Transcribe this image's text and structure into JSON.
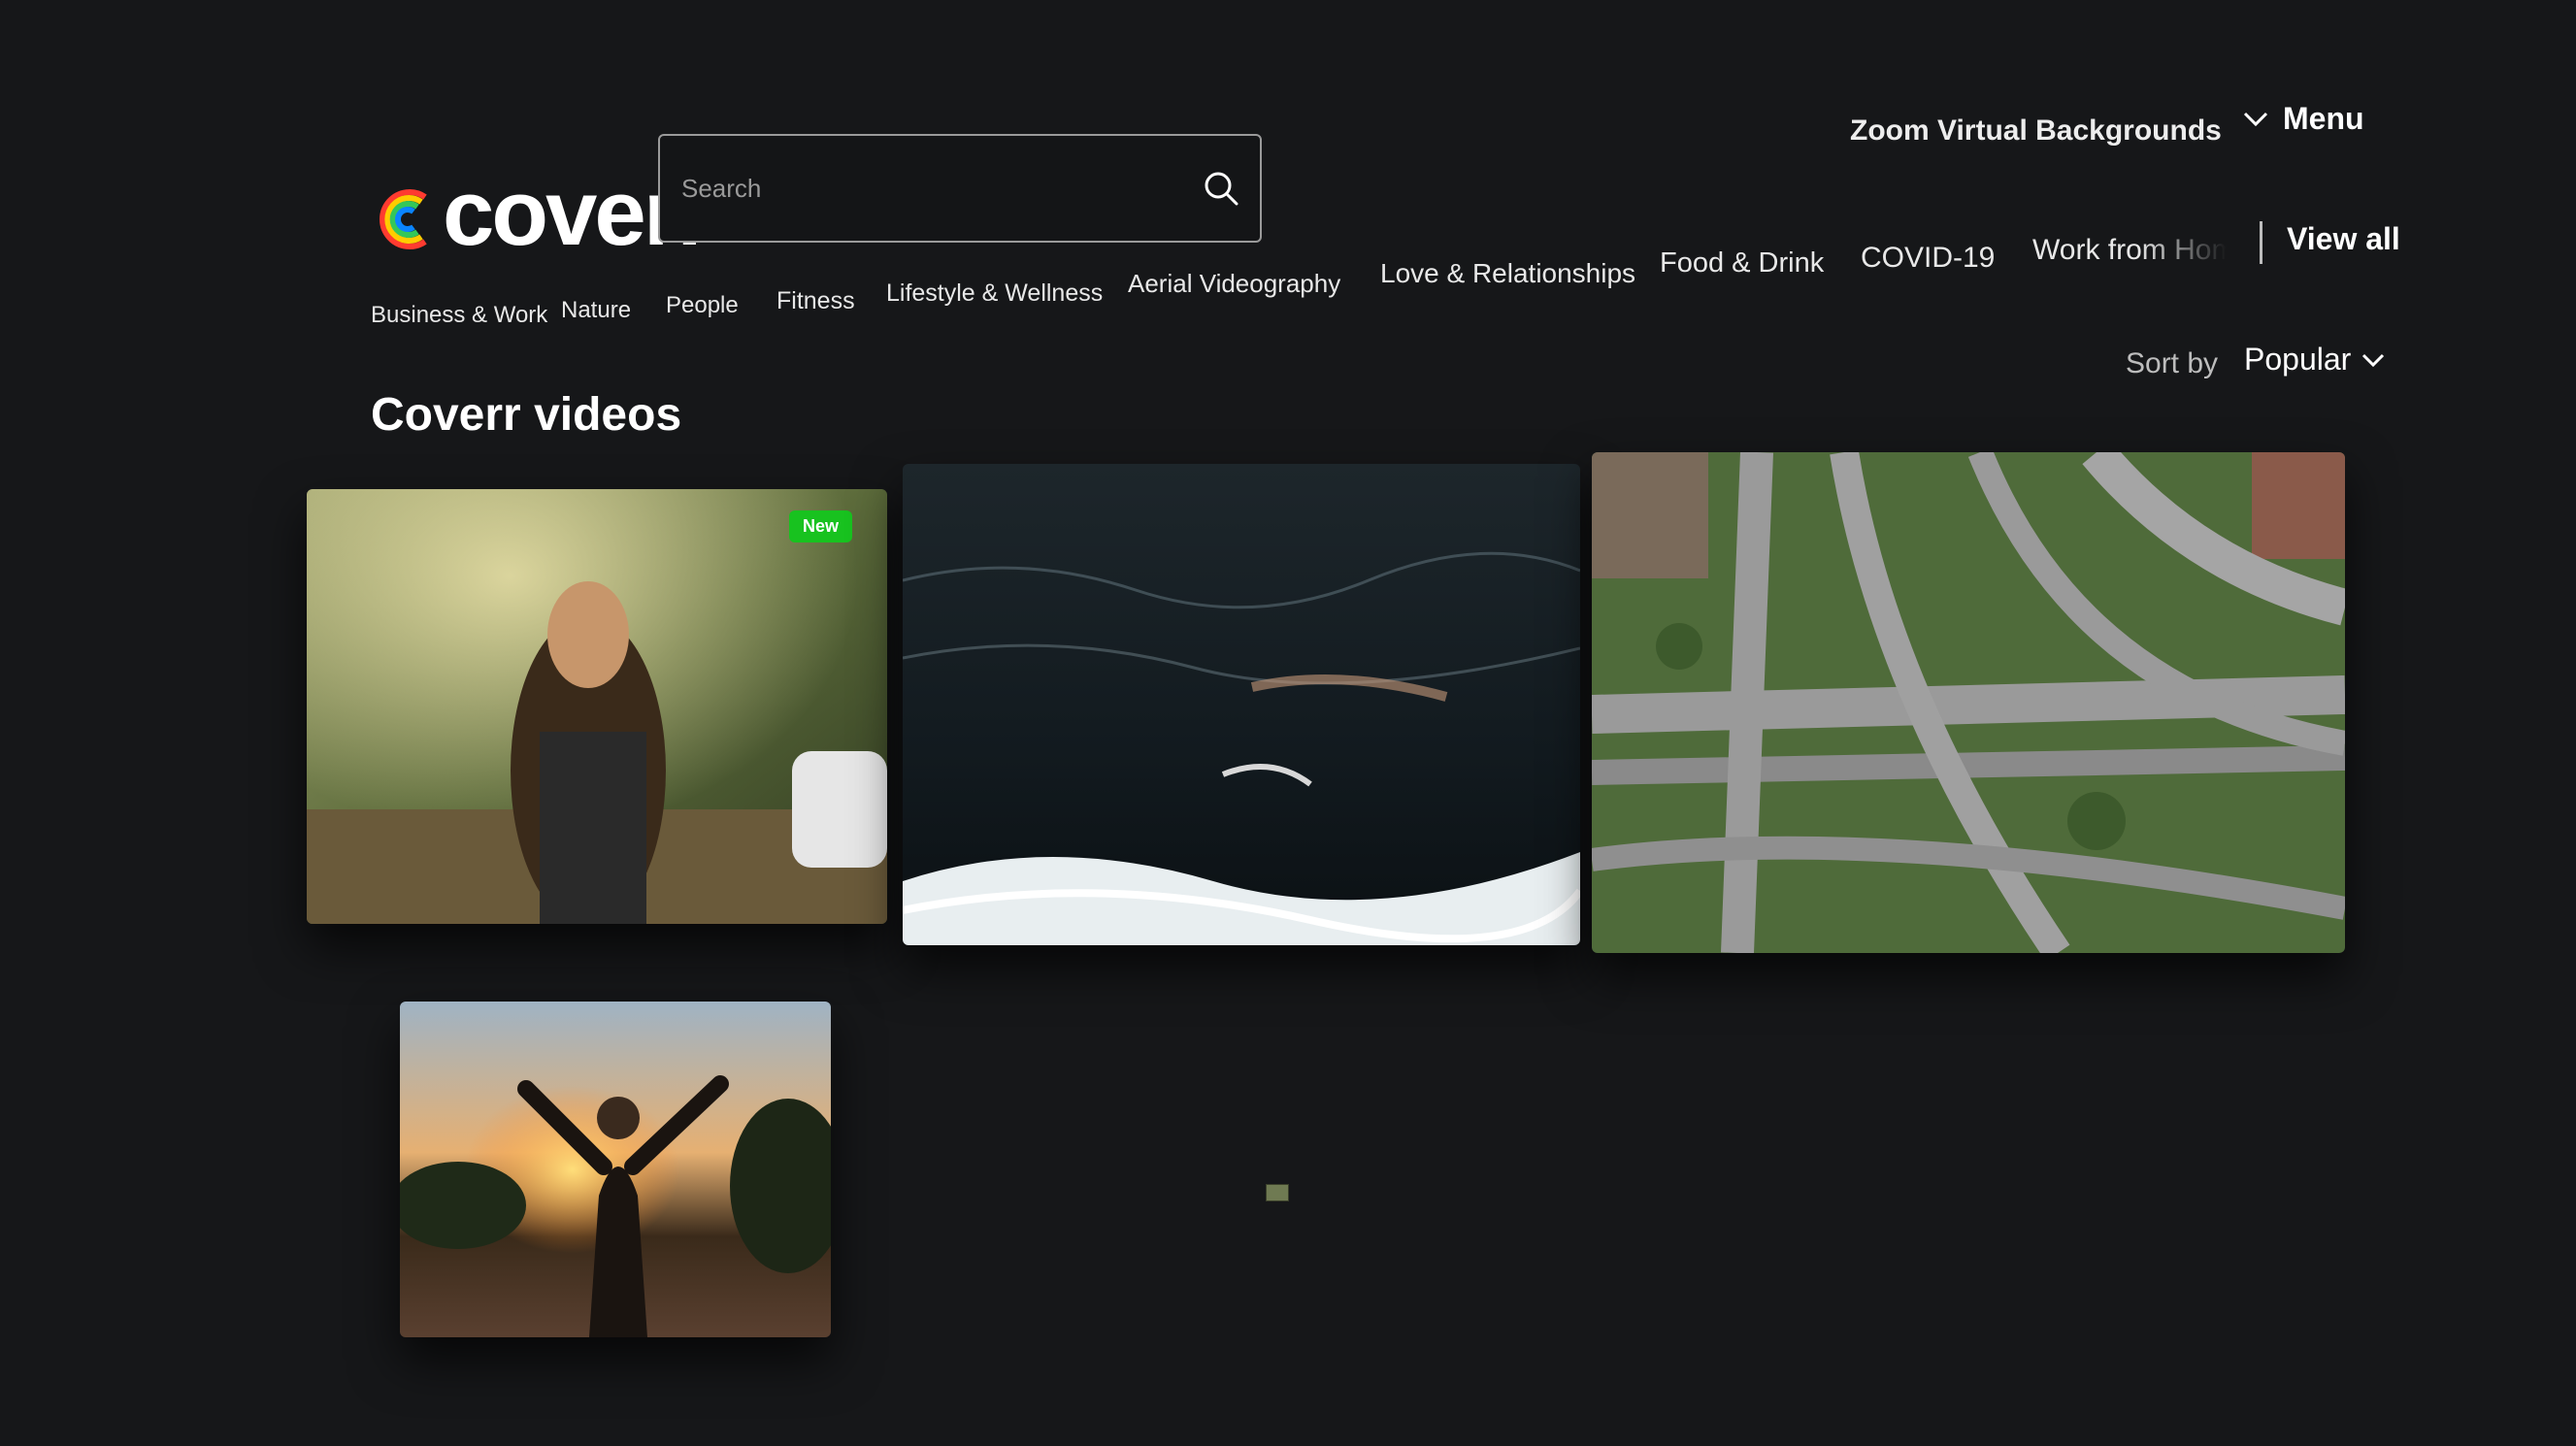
{
  "brand": {
    "name": "coverr"
  },
  "search": {
    "placeholder": "Search"
  },
  "header": {
    "zoom_link": "Zoom Virtual Backgrounds",
    "menu_label": "Menu"
  },
  "categories": [
    "Business & Work",
    "Nature",
    "People",
    "Fitness",
    "Lifestyle & Wellness",
    "Aerial Videography",
    "Love & Relationships",
    "Food & Drink",
    "COVID-19",
    "Work from Hom"
  ],
  "view_all_label": "View all",
  "sort": {
    "label": "Sort by",
    "value": "Popular"
  },
  "page_title": "Coverr videos",
  "videos": [
    {
      "badge": "New"
    }
  ],
  "colors": {
    "background": "#161719",
    "new_badge": "#18c21f",
    "text": "#ffffff"
  }
}
